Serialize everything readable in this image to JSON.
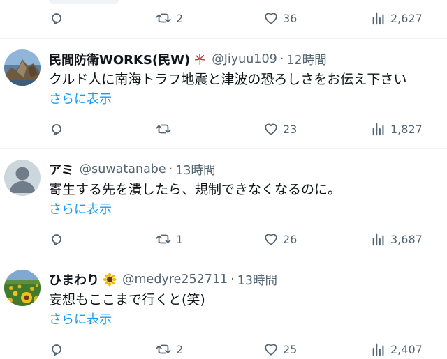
{
  "top_tweet": {
    "retweets": "2",
    "likes": "36",
    "views": "2,627"
  },
  "tweets": [
    {
      "name": "民間防衛WORKS(民W)",
      "name_emoji": "fireworks-sparkle",
      "handle": "@Jiyuu109",
      "separator": "·",
      "time": "12時間",
      "text": "クルド人に南海トラフ地震と津波の恐ろしさをお伝え下さい",
      "show_more": "さらに表示",
      "replies": "",
      "retweets": "",
      "likes": "23",
      "views": "1,827"
    },
    {
      "name": "アミ",
      "handle": "@suwatanabe",
      "separator": "·",
      "time": "13時間",
      "text": "寄生する先を潰したら、規制できなくなるのに。",
      "show_more": "さらに表示",
      "replies": "",
      "retweets": "1",
      "likes": "26",
      "views": "3,687"
    },
    {
      "name": "ひまわり",
      "name_emoji": "sunflower",
      "handle": "@medyre252711",
      "separator": "·",
      "time": "13時間",
      "text": "妄想もここまで行くと(笑)",
      "show_more": "さらに表示",
      "replies": "",
      "retweets": "2",
      "likes": "25",
      "views": "2,407"
    }
  ],
  "colors": {
    "text": "#0f1419",
    "secondary": "#536471",
    "link": "#1d9bf0",
    "divider": "#eff3f4"
  }
}
